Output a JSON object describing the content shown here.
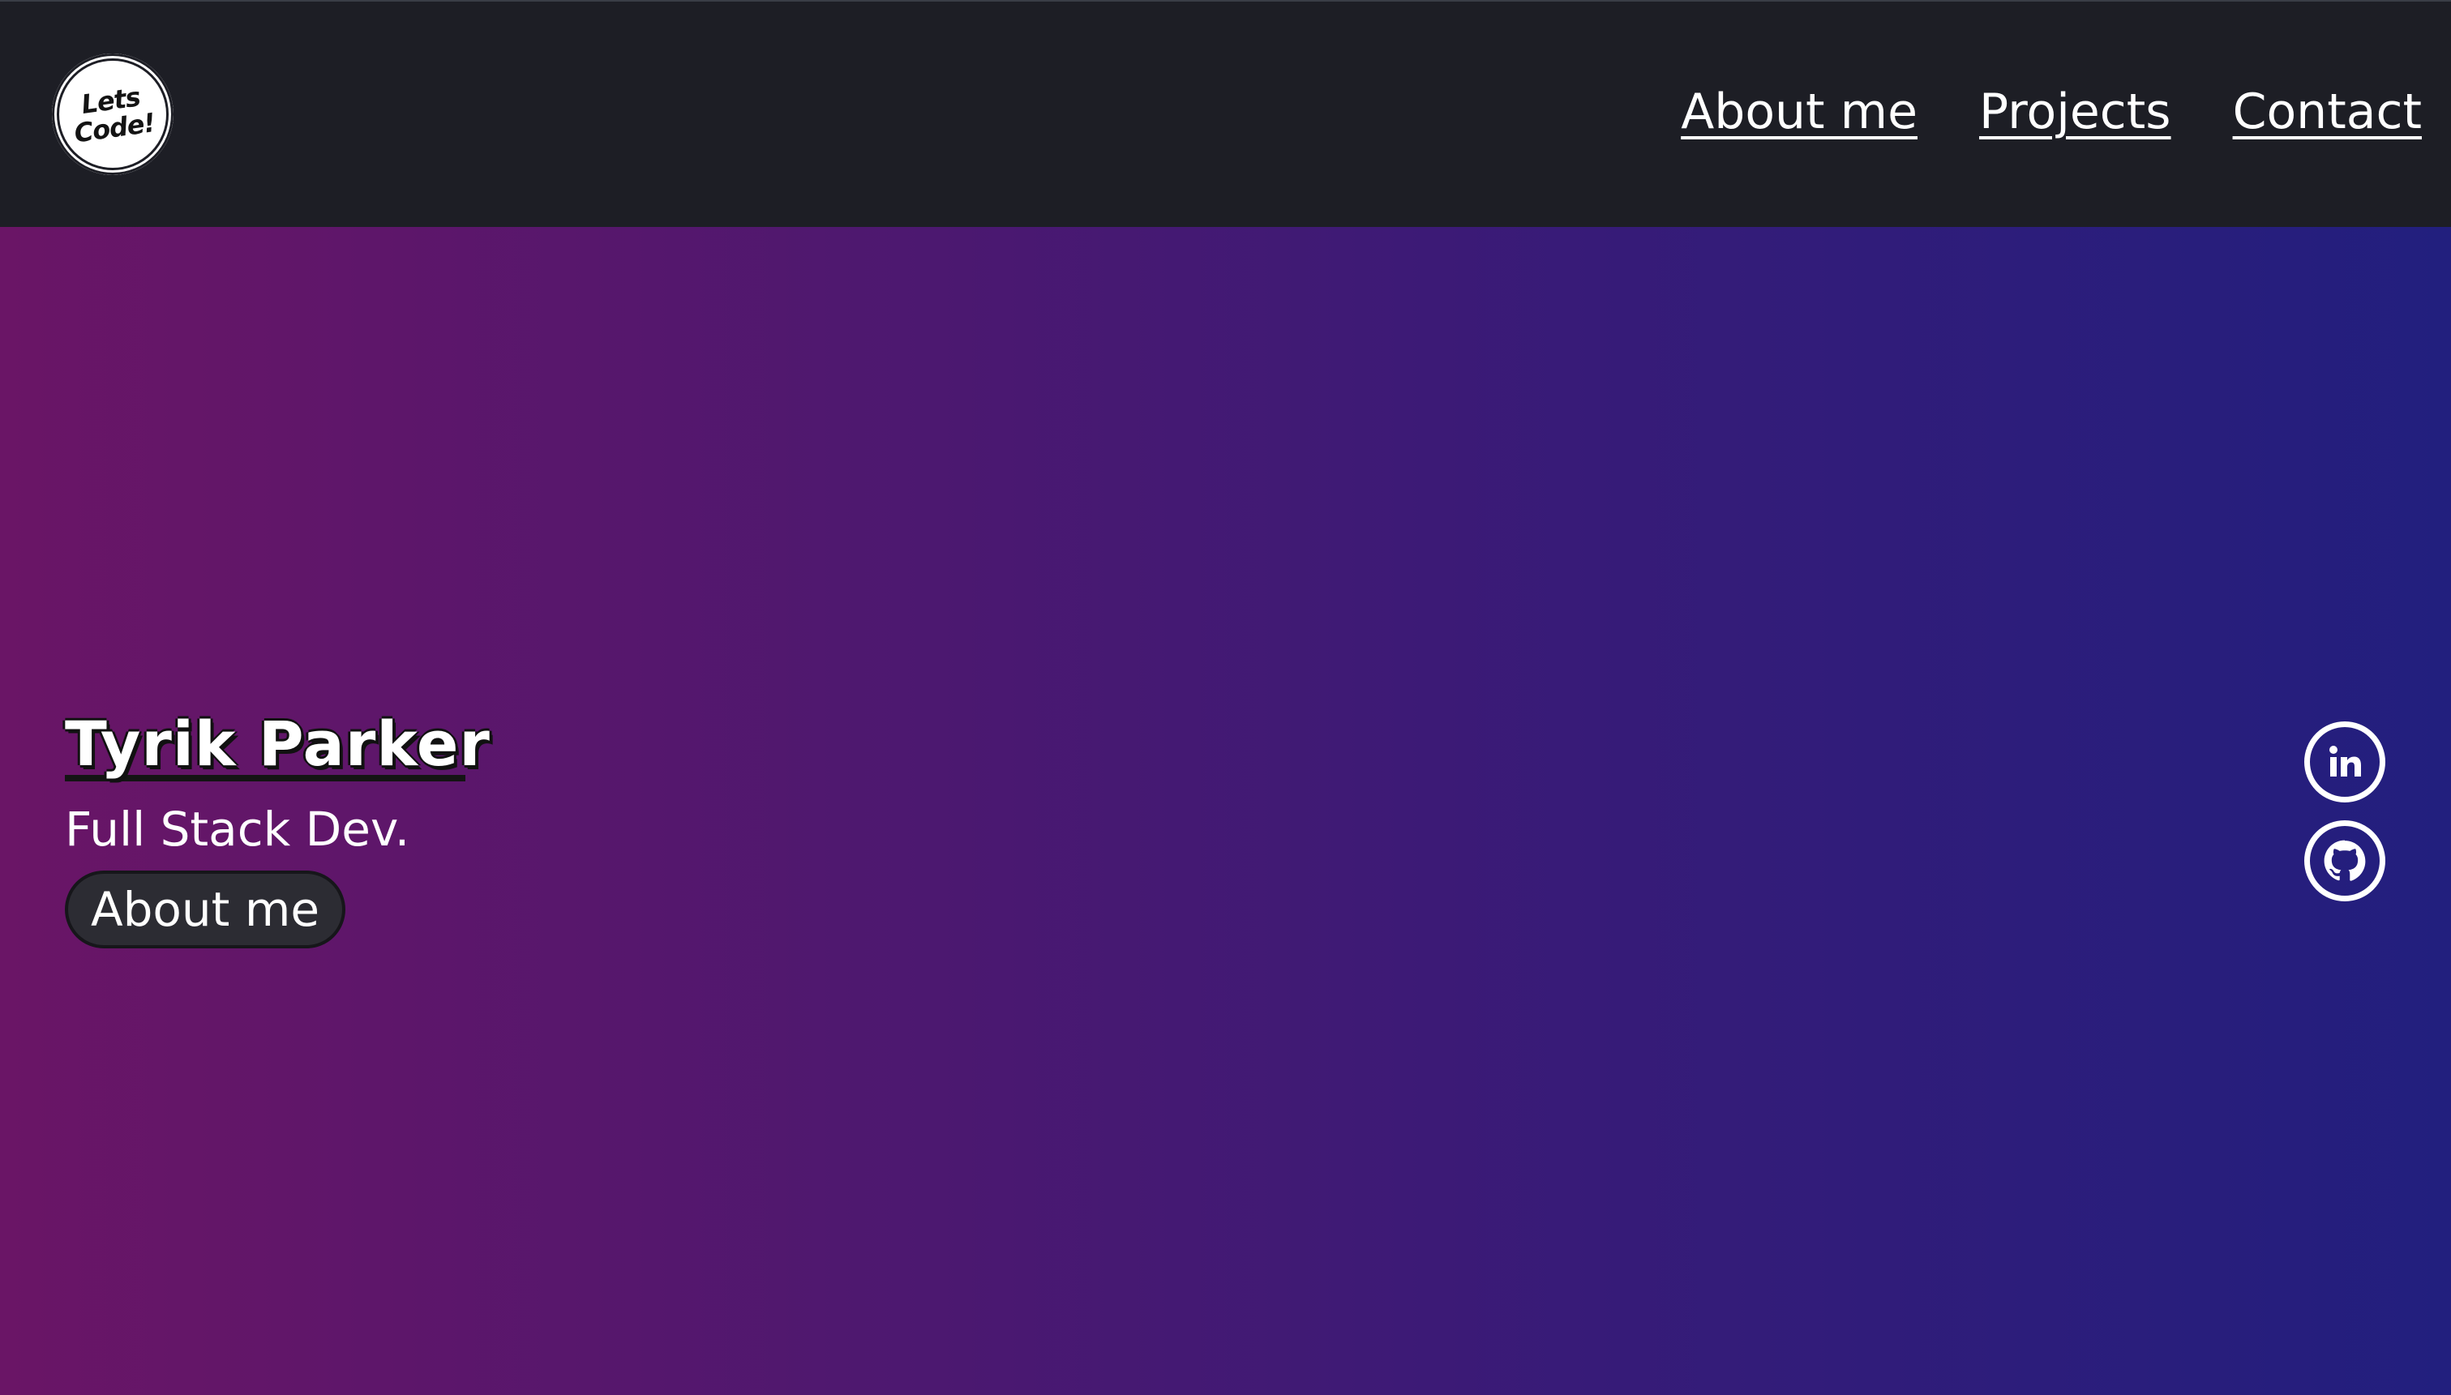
{
  "logo": {
    "text": "Lets\nCode!"
  },
  "nav": {
    "links": [
      {
        "label": "About me"
      },
      {
        "label": "Projects"
      },
      {
        "label": "Contact"
      }
    ]
  },
  "hero": {
    "name": "Tyrik Parker",
    "role": "Full Stack Dev.",
    "button_label": "About me"
  },
  "social": [
    {
      "icon": "linkedin-icon"
    },
    {
      "icon": "github-icon"
    }
  ],
  "colors": {
    "navbar": "#1d1e25",
    "gradient_left": "#6a1566",
    "gradient_right": "#221f7e",
    "button": "#2c2c33",
    "text": "#ffffff"
  }
}
